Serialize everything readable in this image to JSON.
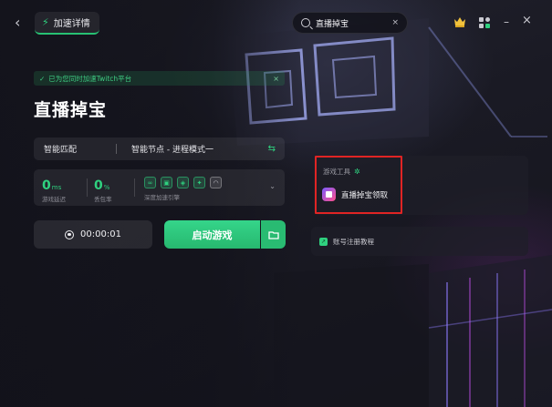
{
  "header": {
    "back_glyph": "‹",
    "tab_label": "加速详情",
    "search_value": "直播掉宝",
    "clear_glyph": "×",
    "minimize_glyph": "–",
    "close_glyph": "×"
  },
  "notice": {
    "text": "已为您同时加速Twitch平台",
    "close_glyph": "×"
  },
  "game": {
    "title": "直播掉宝",
    "match_mode": "智能匹配",
    "node_mode": "智能节点 - 进程模式一",
    "switch_glyph": "⇆"
  },
  "stats": {
    "latency_value": "0",
    "latency_unit": "ms",
    "latency_label": "游戏延迟",
    "loss_value": "0",
    "loss_unit": "%",
    "loss_label": "丢包率",
    "engine_label": "深度加速引擎"
  },
  "actions": {
    "timer": "00:00:01",
    "start_label": "启动游戏"
  },
  "tools": {
    "title": "游戏工具",
    "item_label": "直播掉宝领取"
  },
  "guide": {
    "label": "账号注册教程"
  },
  "colors": {
    "accent": "#2fd17f",
    "highlight": "#e02424",
    "background": "#16161f"
  }
}
